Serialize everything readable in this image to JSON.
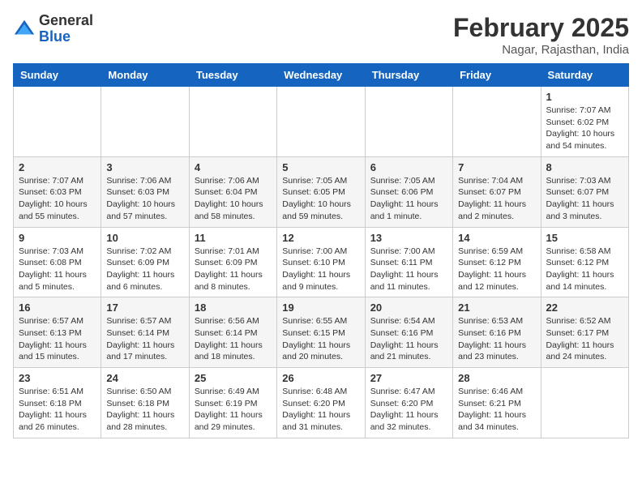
{
  "header": {
    "logo_general": "General",
    "logo_blue": "Blue",
    "month_year": "February 2025",
    "location": "Nagar, Rajasthan, India"
  },
  "days_of_week": [
    "Sunday",
    "Monday",
    "Tuesday",
    "Wednesday",
    "Thursday",
    "Friday",
    "Saturday"
  ],
  "weeks": [
    [
      {
        "day": "",
        "info": ""
      },
      {
        "day": "",
        "info": ""
      },
      {
        "day": "",
        "info": ""
      },
      {
        "day": "",
        "info": ""
      },
      {
        "day": "",
        "info": ""
      },
      {
        "day": "",
        "info": ""
      },
      {
        "day": "1",
        "info": "Sunrise: 7:07 AM\nSunset: 6:02 PM\nDaylight: 10 hours\nand 54 minutes."
      }
    ],
    [
      {
        "day": "2",
        "info": "Sunrise: 7:07 AM\nSunset: 6:03 PM\nDaylight: 10 hours\nand 55 minutes."
      },
      {
        "day": "3",
        "info": "Sunrise: 7:06 AM\nSunset: 6:03 PM\nDaylight: 10 hours\nand 57 minutes."
      },
      {
        "day": "4",
        "info": "Sunrise: 7:06 AM\nSunset: 6:04 PM\nDaylight: 10 hours\nand 58 minutes."
      },
      {
        "day": "5",
        "info": "Sunrise: 7:05 AM\nSunset: 6:05 PM\nDaylight: 10 hours\nand 59 minutes."
      },
      {
        "day": "6",
        "info": "Sunrise: 7:05 AM\nSunset: 6:06 PM\nDaylight: 11 hours\nand 1 minute."
      },
      {
        "day": "7",
        "info": "Sunrise: 7:04 AM\nSunset: 6:07 PM\nDaylight: 11 hours\nand 2 minutes."
      },
      {
        "day": "8",
        "info": "Sunrise: 7:03 AM\nSunset: 6:07 PM\nDaylight: 11 hours\nand 3 minutes."
      }
    ],
    [
      {
        "day": "9",
        "info": "Sunrise: 7:03 AM\nSunset: 6:08 PM\nDaylight: 11 hours\nand 5 minutes."
      },
      {
        "day": "10",
        "info": "Sunrise: 7:02 AM\nSunset: 6:09 PM\nDaylight: 11 hours\nand 6 minutes."
      },
      {
        "day": "11",
        "info": "Sunrise: 7:01 AM\nSunset: 6:09 PM\nDaylight: 11 hours\nand 8 minutes."
      },
      {
        "day": "12",
        "info": "Sunrise: 7:00 AM\nSunset: 6:10 PM\nDaylight: 11 hours\nand 9 minutes."
      },
      {
        "day": "13",
        "info": "Sunrise: 7:00 AM\nSunset: 6:11 PM\nDaylight: 11 hours\nand 11 minutes."
      },
      {
        "day": "14",
        "info": "Sunrise: 6:59 AM\nSunset: 6:12 PM\nDaylight: 11 hours\nand 12 minutes."
      },
      {
        "day": "15",
        "info": "Sunrise: 6:58 AM\nSunset: 6:12 PM\nDaylight: 11 hours\nand 14 minutes."
      }
    ],
    [
      {
        "day": "16",
        "info": "Sunrise: 6:57 AM\nSunset: 6:13 PM\nDaylight: 11 hours\nand 15 minutes."
      },
      {
        "day": "17",
        "info": "Sunrise: 6:57 AM\nSunset: 6:14 PM\nDaylight: 11 hours\nand 17 minutes."
      },
      {
        "day": "18",
        "info": "Sunrise: 6:56 AM\nSunset: 6:14 PM\nDaylight: 11 hours\nand 18 minutes."
      },
      {
        "day": "19",
        "info": "Sunrise: 6:55 AM\nSunset: 6:15 PM\nDaylight: 11 hours\nand 20 minutes."
      },
      {
        "day": "20",
        "info": "Sunrise: 6:54 AM\nSunset: 6:16 PM\nDaylight: 11 hours\nand 21 minutes."
      },
      {
        "day": "21",
        "info": "Sunrise: 6:53 AM\nSunset: 6:16 PM\nDaylight: 11 hours\nand 23 minutes."
      },
      {
        "day": "22",
        "info": "Sunrise: 6:52 AM\nSunset: 6:17 PM\nDaylight: 11 hours\nand 24 minutes."
      }
    ],
    [
      {
        "day": "23",
        "info": "Sunrise: 6:51 AM\nSunset: 6:18 PM\nDaylight: 11 hours\nand 26 minutes."
      },
      {
        "day": "24",
        "info": "Sunrise: 6:50 AM\nSunset: 6:18 PM\nDaylight: 11 hours\nand 28 minutes."
      },
      {
        "day": "25",
        "info": "Sunrise: 6:49 AM\nSunset: 6:19 PM\nDaylight: 11 hours\nand 29 minutes."
      },
      {
        "day": "26",
        "info": "Sunrise: 6:48 AM\nSunset: 6:20 PM\nDaylight: 11 hours\nand 31 minutes."
      },
      {
        "day": "27",
        "info": "Sunrise: 6:47 AM\nSunset: 6:20 PM\nDaylight: 11 hours\nand 32 minutes."
      },
      {
        "day": "28",
        "info": "Sunrise: 6:46 AM\nSunset: 6:21 PM\nDaylight: 11 hours\nand 34 minutes."
      },
      {
        "day": "",
        "info": ""
      }
    ]
  ]
}
